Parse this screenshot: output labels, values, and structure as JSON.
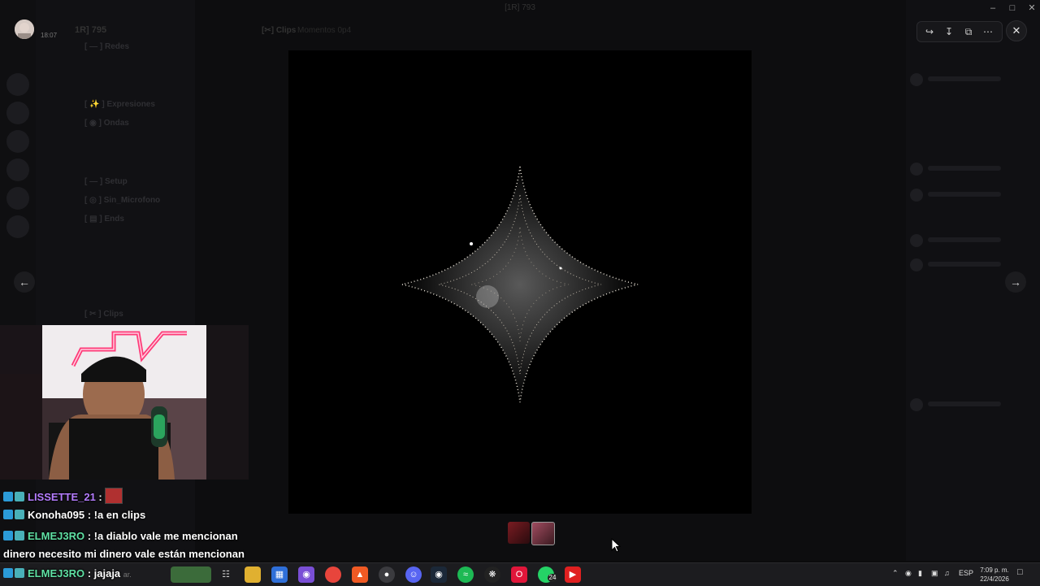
{
  "window": {
    "title": "[1R] 793"
  },
  "top_user": {
    "time": "18:07"
  },
  "server": {
    "name": "1R] 795"
  },
  "channel": {
    "title": "[✂] Clips",
    "description": "Momentos 0p4"
  },
  "channel_list": [
    {
      "label": "[ — ] Redes"
    },
    {
      "label": "[ ✨ ] Expresiones"
    },
    {
      "label": "[ ◉ ] Ondas"
    },
    {
      "label": "[ — ] Setup"
    },
    {
      "label": "[ ◎ ] Sin_Microfono"
    },
    {
      "label": "[ ▤ ] Ends"
    },
    {
      "label": "[ ✂ ] Clips"
    }
  ],
  "viewer_toolbar": {
    "forward_icon": "forward-icon",
    "download_icon": "download-icon",
    "open_icon": "open-external-icon",
    "more_icon": "more-icon"
  },
  "nav": {
    "prev_icon": "←",
    "next_icon": "→"
  },
  "chat": [
    {
      "user": "LISSETTE_21",
      "user_color": "#b57dff",
      "message": ""
    },
    {
      "user": "Konoha095",
      "user_color": "#ffffff",
      "message": "!a en clips"
    },
    {
      "user": "ELMEJ3RO",
      "user_color": "#5fe0a4",
      "message": "!a diablo vale me mencionan"
    },
    {
      "user": "",
      "user_color": "#ffffff",
      "message": "dinero necesito mi dinero vale están mencionan"
    },
    {
      "user": "ELMEJ3RO",
      "user_color": "#5fe0a4",
      "message": "jajaja"
    }
  ],
  "taskbar": {
    "search_placeholder": "ar.",
    "tray_lang": "ESP",
    "time": "7:09 p. m.",
    "date": "22/4/2026",
    "whatsapp_badge": "24"
  },
  "colors": {
    "accent": "#2b9bd8",
    "background": "#0b0b0c"
  }
}
